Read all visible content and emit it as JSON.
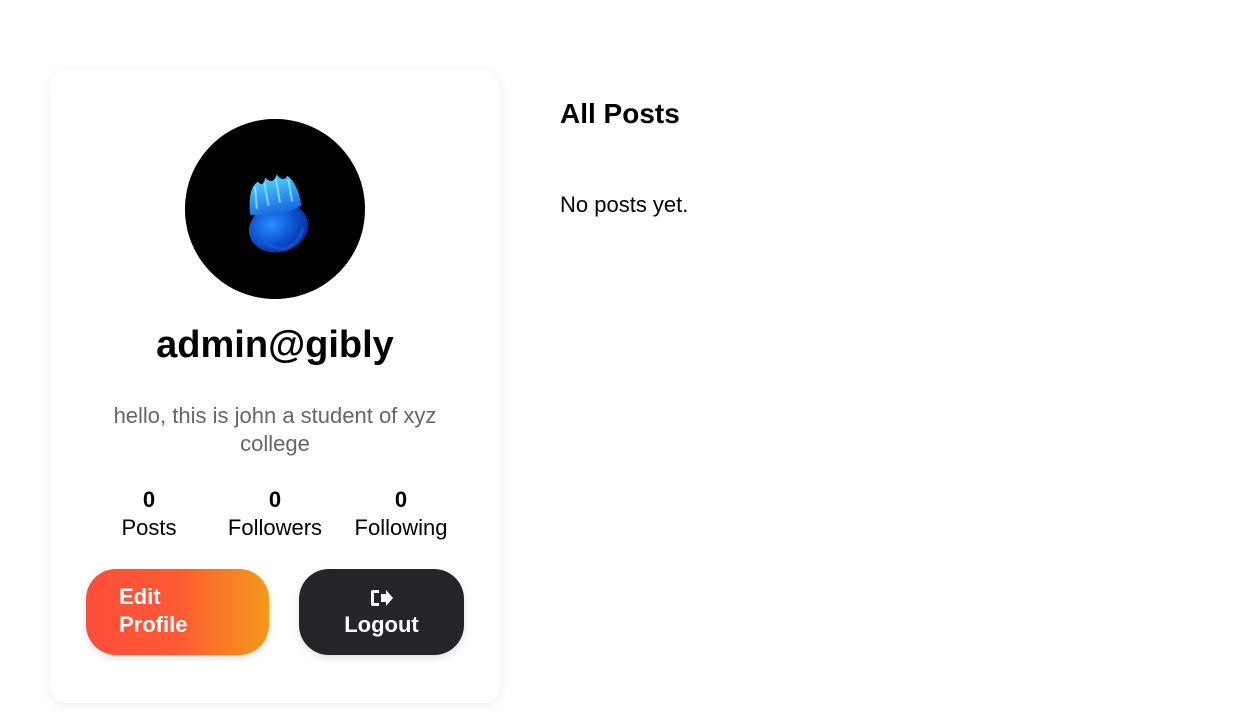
{
  "profile": {
    "avatar_icon": "jellyfish-avatar",
    "username": "admin@gibly",
    "bio": "hello, this is john a student of xyz college",
    "stats": [
      {
        "value": "0",
        "label": "Posts"
      },
      {
        "value": "0",
        "label": "Followers"
      },
      {
        "value": "0",
        "label": "Following"
      }
    ],
    "edit_button_label": "Edit Profile",
    "logout_button_label": "Logout",
    "logout_icon": "sign-out-icon"
  },
  "posts": {
    "title": "All Posts",
    "empty_message": "No posts yet."
  },
  "colors": {
    "edit_gradient_start": "#ff4d3d",
    "edit_gradient_end": "#f39a1a",
    "logout_bg": "#242528",
    "bio_text": "#666666"
  }
}
